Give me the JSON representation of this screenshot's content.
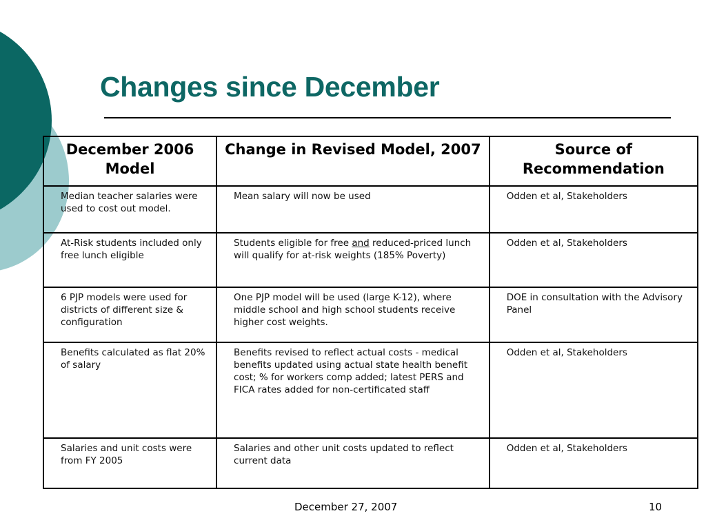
{
  "slide": {
    "title": "Changes since December",
    "theme_colors": {
      "dark_teal": "#0b6763",
      "light_teal": "#9ccbcd",
      "title_color": "#0e6764"
    }
  },
  "table": {
    "headers": [
      "December 2006 Model",
      "Change in Revised Model, 2007",
      "Source of Recommendation"
    ],
    "rows": [
      {
        "december_2006": "Median teacher salaries were used to cost out model.",
        "change_2007": "Mean salary will now be used",
        "source": "Odden et al, Stakeholders"
      },
      {
        "december_2006": "At-Risk students included only free lunch eligible",
        "change_2007_before": "Students eligible for free ",
        "change_2007_emphasis": "and",
        "change_2007_after": " reduced-priced lunch will qualify for at-risk weights (185% Poverty)",
        "source": "Odden et al, Stakeholders"
      },
      {
        "december_2006": "6 PJP models were used for districts of different size & configuration",
        "change_2007": "One PJP model will be used (large K-12), where middle school and high school students receive higher cost weights.",
        "source": "DOE in consultation with the Advisory Panel"
      },
      {
        "december_2006": "Benefits calculated as flat 20% of salary",
        "change_2007": "Benefits revised to reflect actual costs - medical benefits updated using actual state health benefit cost; % for workers comp added; latest PERS and FICA rates added for non-certificated staff",
        "source": "Odden et al, Stakeholders"
      },
      {
        "december_2006": "Salaries and unit costs were from FY 2005",
        "change_2007": "Salaries and other unit costs updated to reflect current data",
        "source": "Odden et al, Stakeholders"
      }
    ]
  },
  "footer": {
    "date": "December 27, 2007",
    "page_number": "10"
  }
}
